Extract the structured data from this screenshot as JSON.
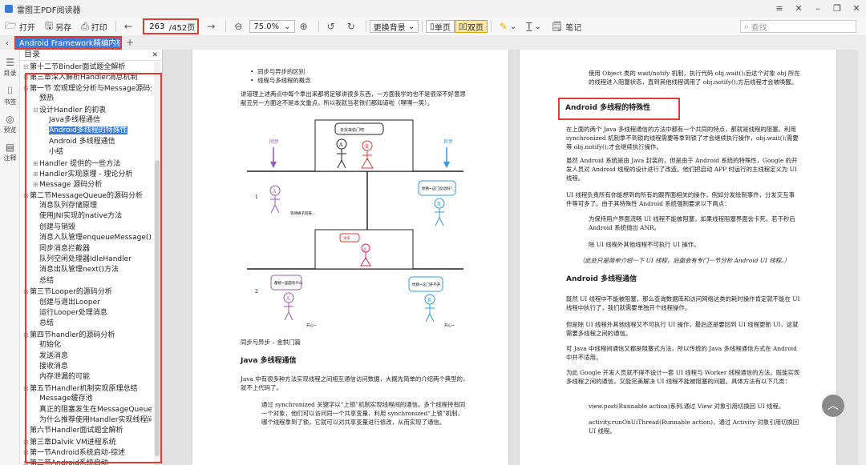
{
  "app": {
    "title": "雷图王PDF阅读器"
  },
  "window_controls": [
    "≡",
    "✕",
    "–",
    "❐",
    "✕"
  ],
  "toolbar": {
    "open": "打开",
    "saveas": "另存",
    "print": "打印",
    "page_current": "263",
    "page_total": "/452页",
    "zoom": "75.0%",
    "background": "更换背景",
    "single": "单页",
    "double": "双页",
    "note": "笔记",
    "search_placeholder": "查找"
  },
  "tab": {
    "label": "Android Framework精编内核",
    "close": "×",
    "add": "+"
  },
  "rail": [
    {
      "icon": "toc-icon",
      "glyph": "☰",
      "label": "目录"
    },
    {
      "icon": "bookmark-icon",
      "glyph": "⌷",
      "label": "书签"
    },
    {
      "icon": "preview-icon",
      "glyph": "◎",
      "label": "预览"
    },
    {
      "icon": "annotation-icon",
      "glyph": "▤",
      "label": "注释"
    }
  ],
  "toc": {
    "title": "目录",
    "items": [
      {
        "t": "第十二节Binder面试题全解析",
        "lvl": 0,
        "tg": "-"
      },
      {
        "t": "第三章深入解析Handler消息机制",
        "lvl": 0,
        "tg": "-"
      },
      {
        "t": "第一节 宏观理论分析与Message源码分析",
        "lvl": 0,
        "tg": "-"
      },
      {
        "t": "预热",
        "lvl": 1,
        "tg": ""
      },
      {
        "t": "设计Handler 的初衷",
        "lvl": 1,
        "tg": "-"
      },
      {
        "t": "Java多线程通信",
        "lvl": 2,
        "tg": ""
      },
      {
        "t": "Android多线程的特殊性",
        "lvl": 2,
        "tg": "",
        "sel": true
      },
      {
        "t": "Android 多线程通信",
        "lvl": 2,
        "tg": ""
      },
      {
        "t": "小结",
        "lvl": 2,
        "tg": ""
      },
      {
        "t": "Handler 提供的一些方法",
        "lvl": 1,
        "tg": "+"
      },
      {
        "t": "Handler实现原理 - 理论分析",
        "lvl": 1,
        "tg": "+"
      },
      {
        "t": "Message 源码分析",
        "lvl": 1,
        "tg": "+"
      },
      {
        "t": "第二节MessageQueue的源码分析",
        "lvl": 0,
        "tg": "-"
      },
      {
        "t": "消息队列存储原理",
        "lvl": 1,
        "tg": ""
      },
      {
        "t": "使用JNI实现的native方法",
        "lvl": 1,
        "tg": ""
      },
      {
        "t": "创建与销毁",
        "lvl": 1,
        "tg": ""
      },
      {
        "t": "消息入队管理enqueueMessage()方法",
        "lvl": 1,
        "tg": ""
      },
      {
        "t": "同步消息拦截器",
        "lvl": 1,
        "tg": ""
      },
      {
        "t": "队列空闲处理器IdleHandler",
        "lvl": 1,
        "tg": ""
      },
      {
        "t": "消息出队管理next()方法",
        "lvl": 1,
        "tg": ""
      },
      {
        "t": "总结",
        "lvl": 1,
        "tg": ""
      },
      {
        "t": "第三节Looper的源码分析",
        "lvl": 0,
        "tg": "-"
      },
      {
        "t": "创建与退出Looper",
        "lvl": 1,
        "tg": ""
      },
      {
        "t": "运行Looper处理消息",
        "lvl": 1,
        "tg": ""
      },
      {
        "t": "总结",
        "lvl": 1,
        "tg": ""
      },
      {
        "t": "第四节handler的源码分析",
        "lvl": 0,
        "tg": "-"
      },
      {
        "t": "初始化",
        "lvl": 1,
        "tg": ""
      },
      {
        "t": "发送消息",
        "lvl": 1,
        "tg": ""
      },
      {
        "t": "接收消息",
        "lvl": 1,
        "tg": ""
      },
      {
        "t": "内存泄漏的可能",
        "lvl": 1,
        "tg": ""
      },
      {
        "t": "第五节Handler机制实现原理总结",
        "lvl": 0,
        "tg": "-"
      },
      {
        "t": "Message缓存池",
        "lvl": 1,
        "tg": ""
      },
      {
        "t": "真正的阻塞发生在MessageQueue",
        "lvl": 1,
        "tg": ""
      },
      {
        "t": "为什么推荐使用Handler实现线程间通",
        "lvl": 1,
        "tg": ""
      },
      {
        "t": "第六节Handler面试题全解析",
        "lvl": 0,
        "tg": ""
      },
      {
        "t": "第三章Dalvik VM进程系统",
        "lvl": 0,
        "tg": "-"
      },
      {
        "t": "第一节Android系统启动-综述",
        "lvl": 0,
        "tg": "+"
      },
      {
        "t": "第二节Android系统启动",
        "lvl": 0,
        "tg": "+"
      }
    ]
  },
  "page1": {
    "bullets": [
      "同步与异步的区别",
      "线程与多线程的概念"
    ],
    "intro": "讲道理上述两点中每个拿出来都将足够讲很多东西，一方面我学的也不是很深不好意思献丑另一方面这不是本文重点，所以我就当老铁们都知道啦（嘿嘿一笑）。",
    "fig_labels": {
      "sync": "同步",
      "async": "异步",
      "row1": "1",
      "row2": "2",
      "bubble1": "去找来偷门吧",
      "bubble2": "进来",
      "bubble3": "你猜~这门没动吗？",
      "bubble4": "都想~里面有什么",
      "bubble5": "你猜~这门开不开",
      "note1": "等待换子回来...",
      "note2": "开心~",
      "note3": "开心~"
    },
    "caption": "同步与异步 – 金拱门篇",
    "h_java": "Java 多线程通信",
    "java_p1": "Java 中有很多种方法实现线程之间相互通信访问数据，大概先简单的介绍两个典型的，就不上代码了。",
    "java_p2": "通过 synchronized 关键字以“上锁”机制实现线程间的通信。多个线程持有同一个对象，他们可以访问同一个共享变量，利用 synchronized“上锁”机制，哪个线程拿到了锁，它就可以对共享变量进行修改，从而实现了通信。"
  },
  "page2": {
    "top": "使用 Object 类的 wait/notify 机制，执行代码 obj.wait();后这个对象 obj 所在的线程进入阻塞状态，直到其他线程调用了 obj.notify();方后线程才会被唤醒。",
    "h_special": "Android 多线程的特殊性",
    "p1": "在上面的两个 Java 多线程通信的方法中都有一个共同的特点，那就是线程的阻塞。利用 synchronized 机制拿不到锁的线程需要等拿到锁了才会继续执行操作，obj.wait();需要等 obj.notify();才会继续执行操作。",
    "p2": "虽然 Android 系统是由 Java 封装的，但是由于 Android 系统的特殊性，Google 的开发人员对 Android 线程的设计进行了改造。他们把启动 APP 时运行的主线程定义为 UI 线程。",
    "p3": "UI 线程负责所有你能想到的所有的跟界面相关的操作，例如分发绘制事件，分发交互事件等可多了。由于其特殊性 Android 系统强制要求以下两点：",
    "p4": "为保持用户界面流畅 UI 线程不能被阻塞，如果线程阻塞界面会卡死，若干秒后 Android 系统抛出 ANR。",
    "p5": "除 UI 线程外其他线程不可执行 UI 操作。",
    "p6": "（此处只是简单介绍一下 UI 线程，后面会有专门一节分析 Android UI 线程。）",
    "h_comm": "Android 多线程通信",
    "p7": "既然 UI 线程中不能被阻塞，那么查询数据库和访问网络这类的耗时操作肯定就不能在 UI 线程中执行了，我们就需要单独开个线程操作。",
    "p8": "但是除 UI 线程外其他线程又不可执行 UI 操作，最后还是要回到 UI 线程更新 UI，这就需要多线程之间的通信。",
    "p9": "可 Java 中线程间通信又都是阻塞式方法，所以传统的 Java 多线程通信方式在 Android 中并不适用。",
    "p10": "为此 Google 开发人员就不得不设计一套 UI 线程与 Worker 线程通信的方法。既能实现多线程之间的通信，又能完美解决 UI 线程不能被阻塞的问题。具体方法有以下几类：",
    "p11": "view.post(Runnable action)系列,通过 View 对象引用切换回 UI 线程。",
    "p12": "activity.runOnUiThread(Runnable action)，通过 Activity 对象引用切换回 UI 线程。"
  },
  "colors": {
    "accent": "#3a7bd5",
    "highlight": "#e53935",
    "purple": "#9b59b6",
    "pink": "#e91e63",
    "blue": "#3498db"
  }
}
